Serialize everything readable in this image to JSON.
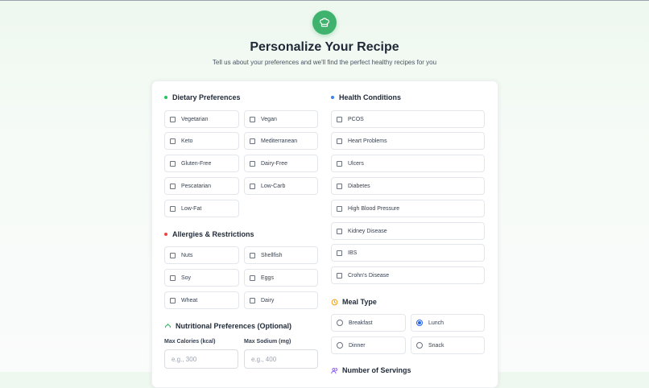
{
  "header": {
    "title": "Personalize Your Recipe",
    "subtitle": "Tell us about your preferences and we'll find the perfect healthy recipes for you"
  },
  "colors": {
    "accent_green": "#3fb36d",
    "diet_dot": "#22c55e",
    "allergy_dot": "#ef4444",
    "health_dot": "#3b82f6",
    "meal_icon": "#f59e0b",
    "servings_icon": "#8b5cf6",
    "radio_selected": "#2563eb"
  },
  "dietary": {
    "title": "Dietary Preferences",
    "options": [
      "Vegetarian",
      "Vegan",
      "Keto",
      "Mediterranean",
      "Gluten-Free",
      "Dairy-Free",
      "Pescatarian",
      "Low-Carb",
      "Low-Fat"
    ]
  },
  "allergies": {
    "title": "Allergies & Restrictions",
    "options": [
      "Nuts",
      "Shellfish",
      "Soy",
      "Eggs",
      "Wheat",
      "Dairy"
    ]
  },
  "nutrition": {
    "title": "Nutritional Preferences (Optional)",
    "calories_label": "Max Calories (kcal)",
    "calories_placeholder": "e.g., 300",
    "sodium_label": "Max Sodium (mg)",
    "sodium_placeholder": "e.g., 400"
  },
  "health": {
    "title": "Health Conditions",
    "options": [
      "PCOS",
      "Heart Problems",
      "Ulcers",
      "Diabetes",
      "High Blood Pressure",
      "Kidney Disease",
      "IBS",
      "Crohn's Disease"
    ]
  },
  "meal": {
    "title": "Meal Type",
    "options": [
      "Breakfast",
      "Lunch",
      "Dinner",
      "Snack"
    ],
    "selected": "Lunch"
  },
  "servings": {
    "title": "Number of Servings"
  }
}
